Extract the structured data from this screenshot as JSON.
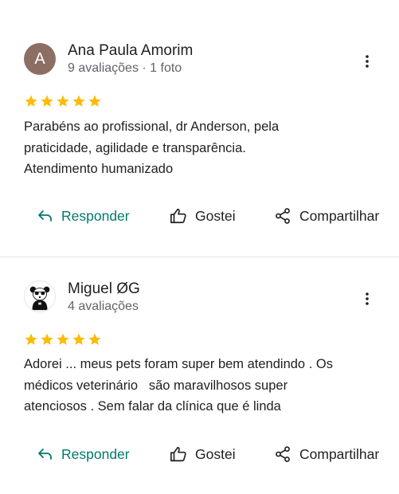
{
  "colors": {
    "accent": "#00796b",
    "star": "#fbbc04",
    "avatar_bg": "#8d6e63"
  },
  "reviews": [
    {
      "avatar_letter": "A",
      "name": "Ana Paula Amorim",
      "meta": "9 avaliações · 1 foto",
      "rating": 5,
      "text_lines": [
        "Parabéns ao profissional, dr Anderson, pela",
        "praticidade, agilidade e transparência.",
        "Atendimento humanizado"
      ],
      "reply_label": "Responder",
      "like_label": "Gostei",
      "share_label": "Compartilhar",
      "more_icon": "more-vert-icon"
    },
    {
      "avatar_icon": "panda-avatar",
      "name": "Miguel ØG",
      "meta": "4 avaliações",
      "rating": 5,
      "text_lines": [
        "Adorei ... meus pets foram super bem atendindo . Os",
        "médicos veterinário   são maravilhosos super",
        "atenciosos . Sem falar da clínica que é linda"
      ],
      "reply_label": "Responder",
      "like_label": "Gostei",
      "share_label": "Compartilhar",
      "more_icon": "more-vert-icon"
    }
  ]
}
